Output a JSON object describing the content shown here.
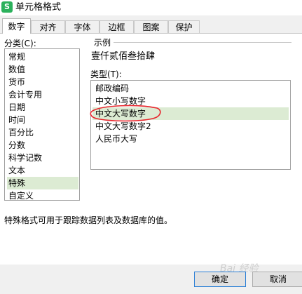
{
  "window": {
    "title": "单元格格式",
    "icon_label": "S"
  },
  "tabs": [
    {
      "label": "数字",
      "active": true
    },
    {
      "label": "对齐",
      "active": false
    },
    {
      "label": "字体",
      "active": false
    },
    {
      "label": "边框",
      "active": false
    },
    {
      "label": "图案",
      "active": false
    },
    {
      "label": "保护",
      "active": false
    }
  ],
  "category": {
    "label": "分类(C):",
    "items": [
      {
        "label": "常规"
      },
      {
        "label": "数值"
      },
      {
        "label": "货币"
      },
      {
        "label": "会计专用"
      },
      {
        "label": "日期"
      },
      {
        "label": "时间"
      },
      {
        "label": "百分比"
      },
      {
        "label": "分数"
      },
      {
        "label": "科学记数"
      },
      {
        "label": "文本"
      },
      {
        "label": "特殊"
      },
      {
        "label": "自定义"
      }
    ],
    "selected": "特殊"
  },
  "sample": {
    "label": "示例",
    "value": "壹仟贰佰叁拾肆"
  },
  "type": {
    "label": "类型(T):",
    "items": [
      {
        "label": "邮政编码"
      },
      {
        "label": "中文小写数字"
      },
      {
        "label": "中文大写数字"
      },
      {
        "label": "中文大写数字2"
      },
      {
        "label": "人民币大写"
      }
    ],
    "selected": "中文大写数字"
  },
  "description": "特殊格式可用于跟踪数据列表及数据库的值。",
  "buttons": {
    "ok": "确定",
    "cancel": "取消"
  },
  "colors": {
    "selection": "#dcebd3",
    "annotation": "#e8232a",
    "primary_border": "#2b7fd6"
  }
}
